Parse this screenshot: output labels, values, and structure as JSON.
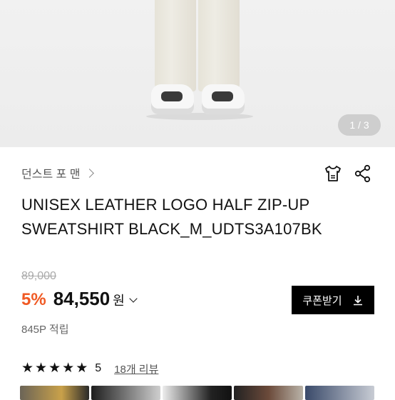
{
  "gallery": {
    "counter": "1 / 3"
  },
  "product": {
    "brand": "던스트 포 맨",
    "title_line1": "UNISEX LEATHER LOGO HALF ZIP-UP",
    "title_line2": "SWEATSHIRT BLACK_M_UDTS3A107BK",
    "original_price": "89,000",
    "discount": "5%",
    "price": "84,550",
    "currency": "원",
    "points": "845P 적립",
    "coupon_label": "쿠폰받기"
  },
  "reviews": {
    "stars": 5,
    "star_glyph": "★",
    "rating": "5",
    "count_label": "18개 리뷰"
  },
  "colors": {
    "discount": "#f05a24",
    "coupon_bg": "#000000"
  },
  "icons": [
    "tshirt-size-icon",
    "share-icon",
    "chevron-right-icon",
    "chevron-down-icon",
    "download-icon",
    "star-icon"
  ]
}
